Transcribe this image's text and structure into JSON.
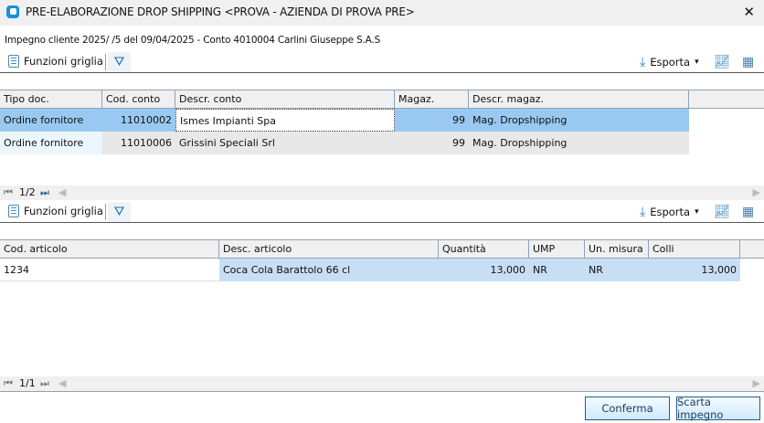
{
  "window": {
    "title": "PRE-ELABORAZIONE DROP SHIPPING <PROVA - AZIENDA DI PROVA PRE>",
    "close": "✕"
  },
  "info": "Impegno cliente 2025/ /5 del 09/04/2025 - Conto 4010004 Carlini Giuseppe S.A.S",
  "toolbar": {
    "funzioni": "Funzioni griglia",
    "esporta": "Esporta",
    "caret": "▾"
  },
  "grid1": {
    "columns": [
      "Tipo doc.",
      "Cod. conto",
      "Descr. conto",
      "Magaz.",
      "Descr. magaz."
    ],
    "rows": [
      [
        "Ordine fornitore",
        "11010002",
        "Ismes Impianti Spa",
        "99",
        "Mag. Dropshipping"
      ],
      [
        "Ordine fornitore",
        "11010006",
        "Grissini Speciali Srl",
        "99",
        "Mag. Dropshipping"
      ]
    ],
    "page": "1/2"
  },
  "grid2": {
    "columns": [
      "Cod. articolo",
      "Desc. articolo",
      "Quantità",
      "UMP",
      "Un. misura",
      "Colli"
    ],
    "rows": [
      [
        "1234",
        "Coca Cola Barattolo 66 cl",
        "13,000",
        "NR",
        "NR",
        "13,000"
      ]
    ],
    "page": "1/1"
  },
  "buttons": {
    "confirm": "Conferma",
    "discard": "Scarta impegno"
  },
  "colors": {
    "selected": "#99c9f0",
    "light_selected": "#c8def5",
    "accent": "#1a8fd8"
  }
}
